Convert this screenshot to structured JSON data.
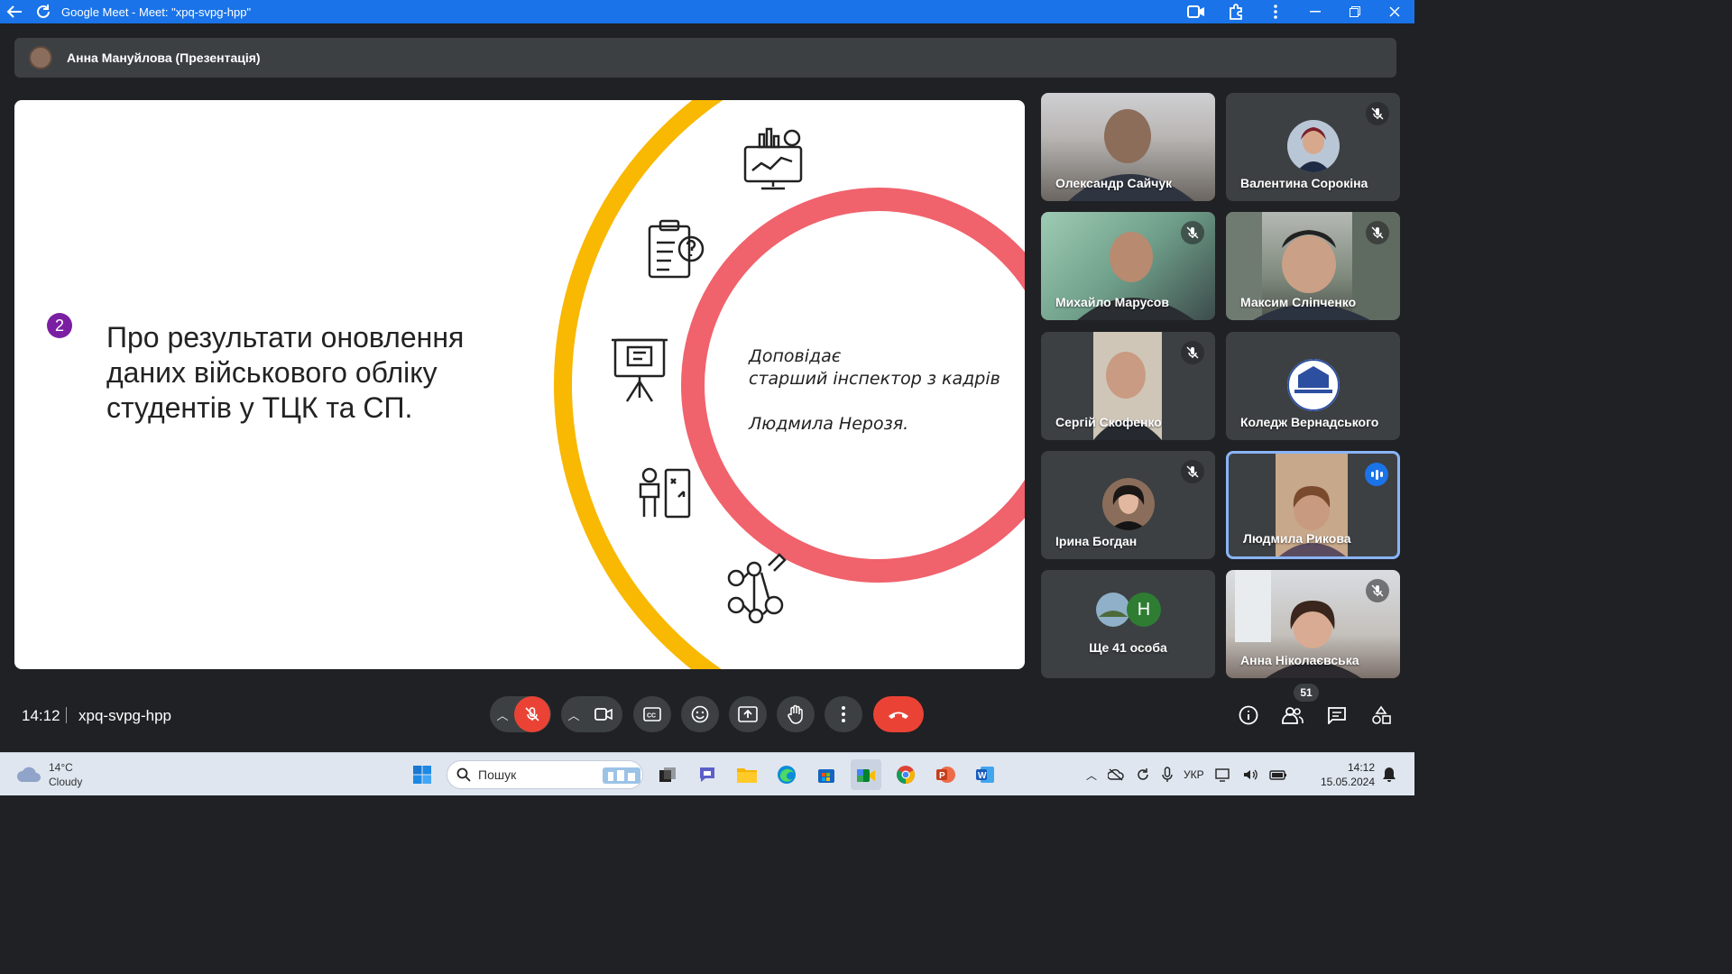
{
  "window": {
    "title": "Google Meet - Meet: \"xpq-svpg-hpp\""
  },
  "presenter": {
    "label": "Анна Мануйлова (Презентація)"
  },
  "slide": {
    "badge": "2",
    "title": "Про результати оновлення даних військового обліку студентів у ТЦК та СП.",
    "speaker_line1": "Доповідає",
    "speaker_line2": "старший інспектор з кадрів",
    "speaker_name": "Людмила Нерозя."
  },
  "participants": [
    {
      "name": "Олександр Сайчук",
      "muted": false
    },
    {
      "name": "Валентина Сорокіна",
      "muted": true
    },
    {
      "name": "Михайло Марусов",
      "muted": true
    },
    {
      "name": "Максим Сліпченко",
      "muted": true
    },
    {
      "name": "Сергій Скофенко",
      "muted": true
    },
    {
      "name": "Коледж Вернадського",
      "muted": false
    },
    {
      "name": "Ірина Богдан",
      "muted": true
    },
    {
      "name": "Людмила Рикова",
      "speaking": true
    },
    {
      "name": "Ще 41 особа",
      "avatar_letter": "Н"
    },
    {
      "name": "Анна Ніколаєвська",
      "muted": true
    }
  ],
  "meeting": {
    "time": "14:12",
    "code": "xpq-svpg-hpp",
    "participant_count": "51"
  },
  "colors": {
    "accent": "#1a73e8",
    "danger": "#ea4335",
    "ring_outer": "#f9b801",
    "ring_inner": "#f0626c"
  },
  "taskbar": {
    "weather_temp": "14°C",
    "weather_desc": "Cloudy",
    "search_placeholder": "Пошук",
    "lang": "УКР",
    "time": "14:12",
    "date": "15.05.2024"
  }
}
